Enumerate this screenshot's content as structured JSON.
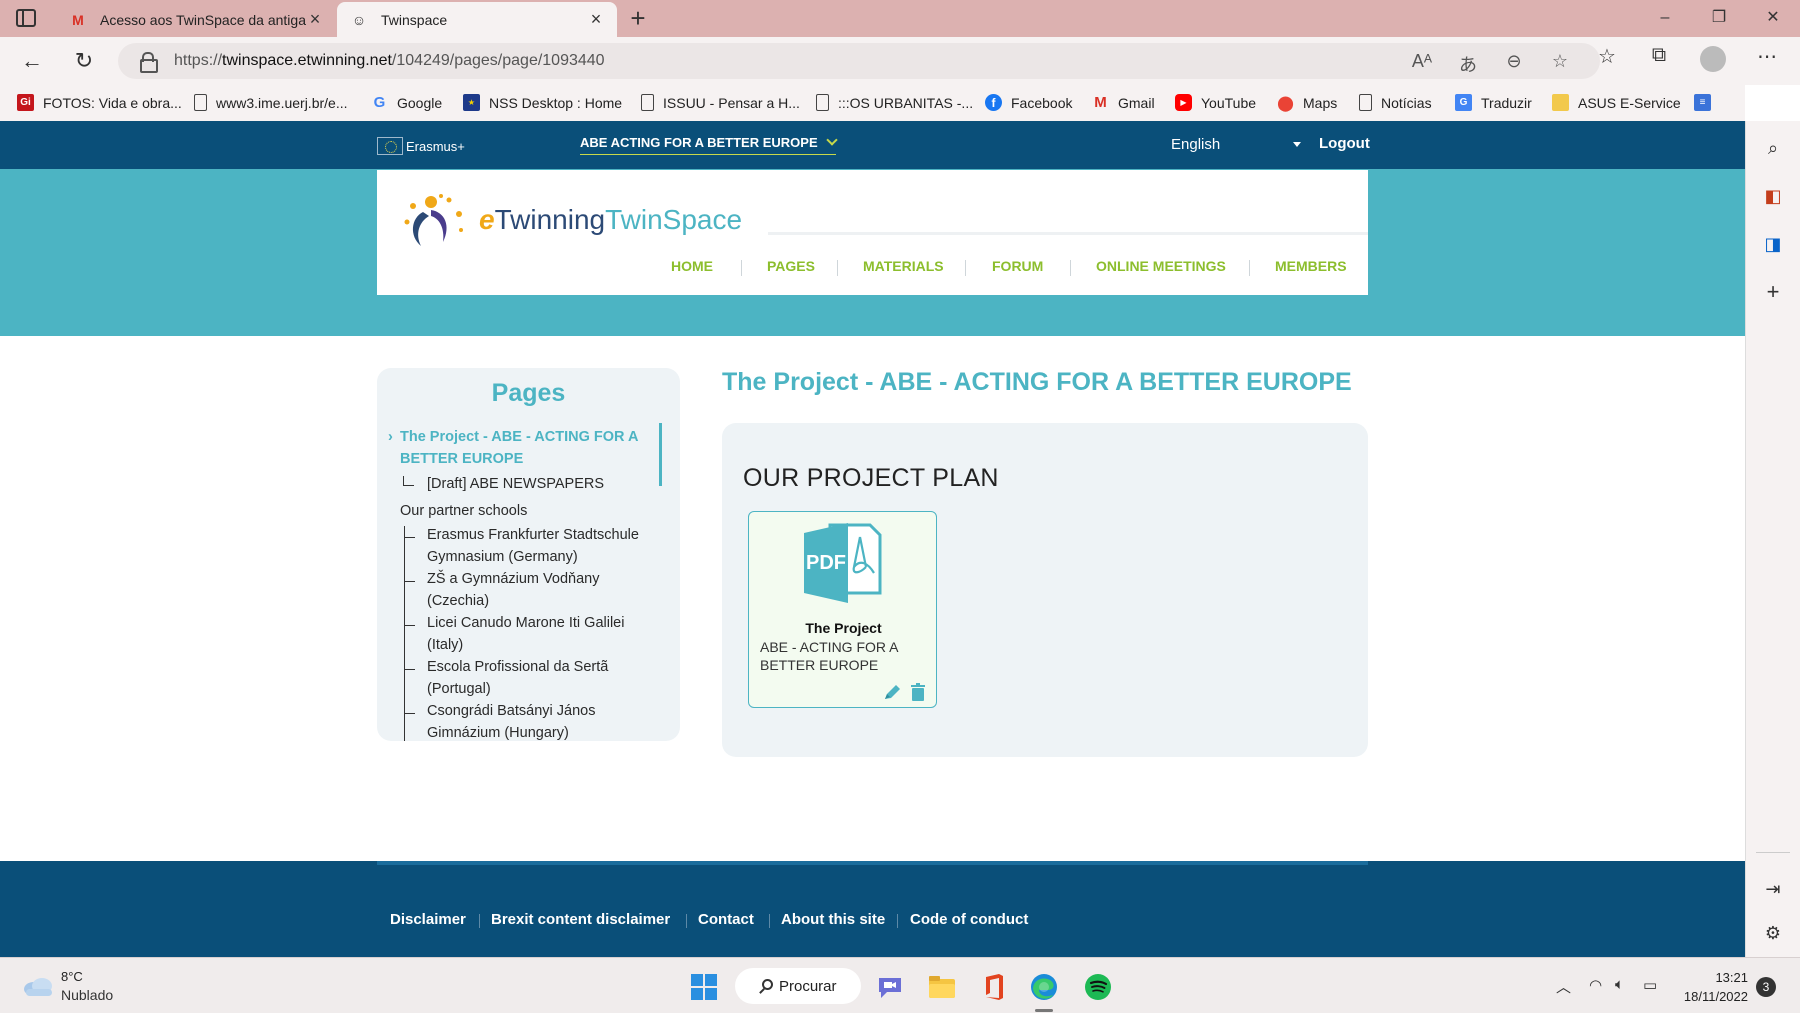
{
  "browser": {
    "tabs": [
      {
        "title": "Acesso aos TwinSpace da antiga",
        "favicon": "gmail-icon"
      },
      {
        "title": "Twinspace",
        "favicon": "twinspace-icon"
      }
    ],
    "url_prefix": "https://",
    "url_domain": "twinspace.etwinning.net",
    "url_path": "/104249/pages/page/1093440",
    "bookmarks": [
      {
        "label": "FOTOS: Vida e obra...",
        "icon": "gi-icon"
      },
      {
        "label": "www3.ime.uerj.br/e...",
        "icon": "page-icon"
      },
      {
        "label": "Google",
        "icon": "google-icon"
      },
      {
        "label": "NSS Desktop : Home",
        "icon": "eu-flag-icon"
      },
      {
        "label": "ISSUU - Pensar a H...",
        "icon": "page-icon"
      },
      {
        "label": ":::OS URBANITAS -...",
        "icon": "page-icon"
      },
      {
        "label": "Facebook",
        "icon": "facebook-icon"
      },
      {
        "label": "Gmail",
        "icon": "gmail-icon"
      },
      {
        "label": "YouTube",
        "icon": "youtube-icon"
      },
      {
        "label": "Maps",
        "icon": "maps-icon"
      },
      {
        "label": "Notícias",
        "icon": "page-icon"
      },
      {
        "label": "Traduzir",
        "icon": "translate-icon"
      },
      {
        "label": "ASUS E-Service",
        "icon": "folder-icon"
      }
    ]
  },
  "site": {
    "topbar": {
      "brand": "Erasmus+",
      "project": "ABE ACTING FOR A BETTER EUROPE",
      "language": "English",
      "logout": "Logout"
    },
    "logo": {
      "e": "e",
      "twinning": "Twinning",
      "twinspace": "TwinSpace"
    },
    "nav": [
      "HOME",
      "PAGES",
      "MATERIALS",
      "FORUM",
      "ONLINE MEETINGS",
      "MEMBERS"
    ],
    "sidebar": {
      "title": "Pages",
      "current_line1": "The Project - ABE - ACTING FOR A",
      "current_line2": "BETTER EUROPE",
      "child_draft": "[Draft] ABE NEWSPAPERS",
      "section": "Our partner schools",
      "schools": [
        {
          "line1": "Erasmus Frankfurter Stadtschule",
          "line2": "Gymnasium (Germany)"
        },
        {
          "line1": "ZŠ a Gymnázium Vodňany",
          "line2": "(Czechia)"
        },
        {
          "line1": "Licei Canudo Marone Iti Galilei",
          "line2": "(Italy)"
        },
        {
          "line1": "Escola Profissional da Sertã",
          "line2": "(Portugal)"
        },
        {
          "line1": "Csongrádi Batsányi János",
          "line2": "Gimnázium (Hungary)"
        }
      ]
    },
    "page_title": "The Project - ABE - ACTING FOR A BETTER EUROPE",
    "section_heading": "OUR PROJECT PLAN",
    "file": {
      "type_label": "PDF",
      "title": "The Project",
      "description": "ABE - ACTING FOR A BETTER EUROPE"
    },
    "footer": [
      "Disclaimer",
      "Brexit content disclaimer",
      "Contact",
      "About this site",
      "Code of conduct"
    ]
  },
  "taskbar": {
    "weather_temp": "8°C",
    "weather_desc": "Nublado",
    "search": "Procurar",
    "time": "13:21",
    "date": "18/11/2022",
    "notifications": "3"
  },
  "colors": {
    "tab_strip": "#dcb1b0",
    "site_navy": "#0a4f79",
    "site_teal": "#4cb4c3",
    "nav_green": "#8cbe2d",
    "panel": "#eef3f6"
  }
}
